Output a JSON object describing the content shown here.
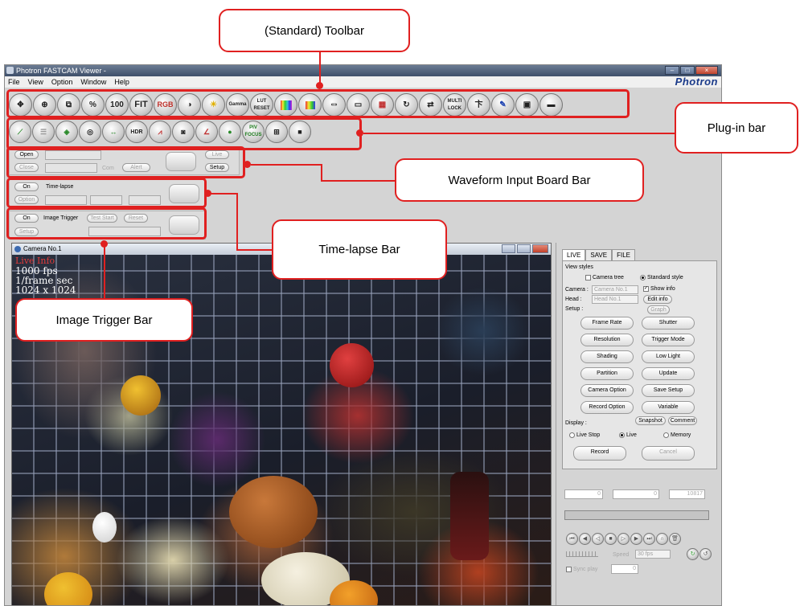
{
  "window": {
    "title": "Photron FASTCAM Viewer -",
    "brand": "Photron"
  },
  "menu": [
    "File",
    "View",
    "Option",
    "Window",
    "Help"
  ],
  "toolbar_icons": [
    "move-icon",
    "zoom-icon",
    "crop-icon",
    "percent-icon",
    "100-percent-icon",
    "fit-icon",
    "rgb-icon",
    "contrast-icon",
    "brightness-icon",
    "gamma-icon",
    "lut-reset-icon",
    "color-bars-icon",
    "color-reset-icon",
    "bayer-icon",
    "rectangle-icon",
    "grid-icon",
    "rotate-icon",
    "flip-icon",
    "multi-lock-icon",
    "measure-icon",
    "pen-icon",
    "info-icon",
    "eraser-icon"
  ],
  "toolbar_labels": {
    "pct": "%",
    "hundred": "100",
    "fit": "FIT",
    "rgb": "RGB",
    "gamma": "Gamma",
    "lut": "LUT RESET",
    "multi": "MULTI LOCK"
  },
  "plugin_labels": {
    "hdr": "HDR",
    "piv": "PIV FOCUS"
  },
  "waveform_bar": {
    "open": "Open",
    "close": "Close",
    "live": "Live",
    "setup": "Setup",
    "alert": "Alert",
    "com": "Com"
  },
  "timelapse_bar": {
    "on": "On",
    "label": "Time-lapse",
    "option": "Option"
  },
  "trigger_bar": {
    "on": "On",
    "label": "Image Trigger",
    "test_start": "Test Start",
    "reset": "Reset",
    "setup": "Setup"
  },
  "camera_window": {
    "title": "Camera No.1",
    "overlay": [
      "Live Info",
      "1000 fps",
      "1/frame sec",
      "1024 x 1024"
    ]
  },
  "side_panel": {
    "tabs": [
      "LIVE",
      "SAVE",
      "FILE"
    ],
    "view_styles": "View styles",
    "camera_tree": "Camera tree",
    "standard_style": "Standard style",
    "camera_label": "Camera :",
    "camera_value": "Camera No.1",
    "head_label": "Head :",
    "head_value": "Head No.1",
    "show_info": "Show info",
    "edit_info": "Edit info",
    "setup_label": "Setup :",
    "graph": "Graph",
    "buttons": [
      "Frame Rate",
      "Shutter",
      "Resolution",
      "Trigger Mode",
      "Shading",
      "Low Light",
      "Partition",
      "Update",
      "Camera Option",
      "Save Setup",
      "Record Option",
      "Variable"
    ],
    "display_label": "Display :",
    "snapshot": "Snapshot",
    "comment": "Comment",
    "live_stop": "Live Stop",
    "live": "Live",
    "memory": "Memory",
    "record": "Record",
    "cancel": "Cancel",
    "frame_start": "0",
    "frame_mid": "0",
    "frame_end": "10817",
    "fps_value": "30 fps",
    "speed_label": "Speed",
    "sync_label": "Sync play",
    "step_value": "0"
  },
  "callouts": {
    "toolbar": "(Standard) Toolbar",
    "plugin": "Plug-in bar",
    "waveform": "Waveform Input Board Bar",
    "timelapse": "Time-lapse Bar",
    "trigger": "Image Trigger Bar"
  },
  "colors": {
    "accent": "#e02020",
    "brand": "#1a3a8a"
  }
}
